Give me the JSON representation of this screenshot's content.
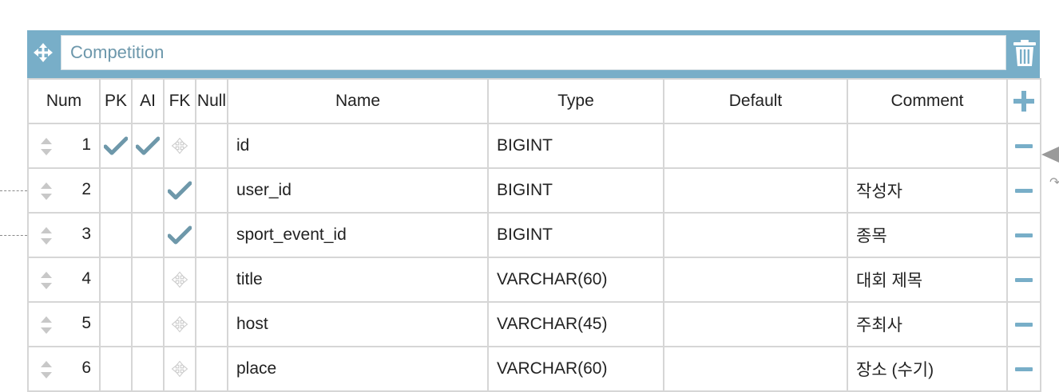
{
  "table": {
    "name": "Competition",
    "columns_header": {
      "num": "Num",
      "pk": "PK",
      "ai": "AI",
      "fk": "FK",
      "null": "Null",
      "name": "Name",
      "type": "Type",
      "default": "Default",
      "comment": "Comment"
    },
    "rows": [
      {
        "num": "1",
        "pk": true,
        "ai": true,
        "fk": false,
        "null": false,
        "name": "id",
        "type": "BIGINT",
        "default": "",
        "comment": ""
      },
      {
        "num": "2",
        "pk": false,
        "ai": false,
        "fk": true,
        "null": false,
        "name": "user_id",
        "type": "BIGINT",
        "default": "",
        "comment": "작성자"
      },
      {
        "num": "3",
        "pk": false,
        "ai": false,
        "fk": true,
        "null": false,
        "name": "sport_event_id",
        "type": "BIGINT",
        "default": "",
        "comment": "종목"
      },
      {
        "num": "4",
        "pk": false,
        "ai": false,
        "fk": false,
        "null": false,
        "name": "title",
        "type": "VARCHAR(60)",
        "default": "",
        "comment": "대회 제목"
      },
      {
        "num": "5",
        "pk": false,
        "ai": false,
        "fk": false,
        "null": false,
        "name": "host",
        "type": "VARCHAR(45)",
        "default": "",
        "comment": "주최사"
      },
      {
        "num": "6",
        "pk": false,
        "ai": false,
        "fk": false,
        "null": false,
        "name": "place",
        "type": "VARCHAR(60)",
        "default": "",
        "comment": "장소 (수기)"
      }
    ]
  },
  "icons": {
    "move": "move-arrows-icon",
    "delete_table": "trash-icon",
    "add_column": "plus-icon",
    "remove_column": "minus-icon",
    "sort": "sort-handle-icon",
    "check": "check-icon",
    "fk_drag": "fk-drag-icon"
  },
  "colors": {
    "header_bar": "#78aec8",
    "table_name_text": "#6c97ab",
    "check": "#6e98aa",
    "fk_drag_faint": "#cccccc",
    "border": "#d6d6d6"
  }
}
